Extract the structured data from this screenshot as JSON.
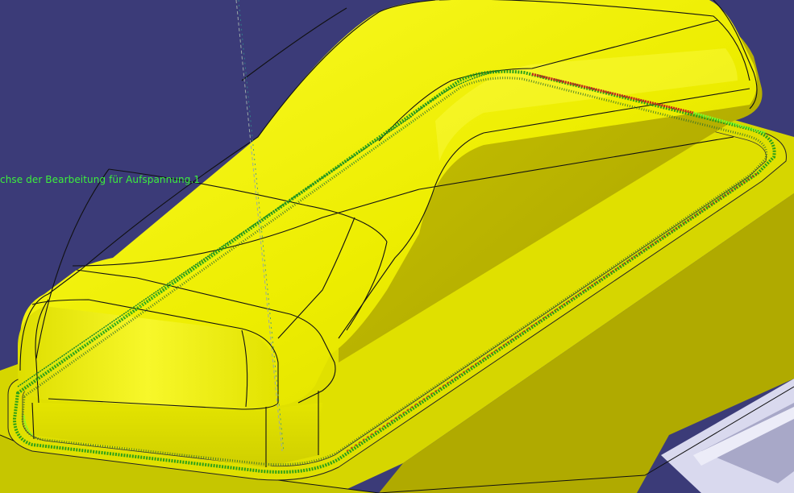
{
  "viewport": {
    "background": "#3b3b78",
    "part_color": "#f2f200",
    "toolpath_colors": [
      "#1a9a1a",
      "#c81e1e",
      "#7dff2a"
    ]
  },
  "annotations": {
    "machining_axis_label": "chse der Bearbeitung für Aufspannung.1"
  }
}
